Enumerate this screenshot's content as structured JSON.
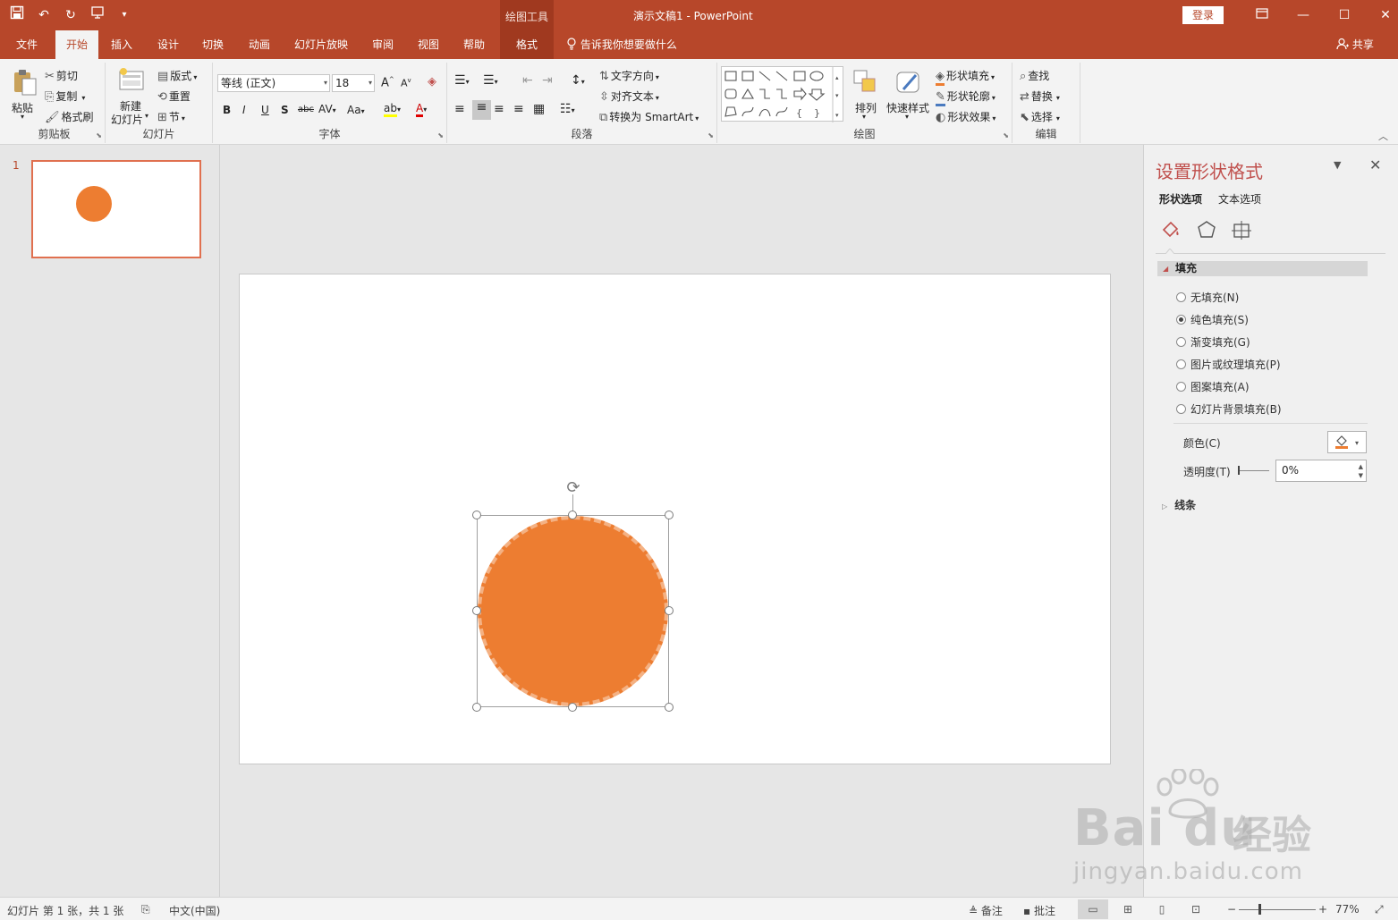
{
  "app": {
    "doc_title": "演示文稿1  -  PowerPoint",
    "context_tools_label": "绘图工具",
    "login": "登录",
    "accent": "#b7472a"
  },
  "qat": {
    "save": "save-icon",
    "undo": "undo-icon",
    "redo": "redo-icon",
    "present": "slideshow-icon",
    "customize": "customize-icon"
  },
  "tabs": [
    {
      "label": "文件"
    },
    {
      "label": "开始"
    },
    {
      "label": "插入"
    },
    {
      "label": "设计"
    },
    {
      "label": "切换"
    },
    {
      "label": "动画"
    },
    {
      "label": "幻灯片放映"
    },
    {
      "label": "审阅"
    },
    {
      "label": "视图"
    },
    {
      "label": "帮助"
    },
    {
      "label": "格式"
    }
  ],
  "tell_me": "告诉我你想要做什么",
  "share": "共享",
  "ribbon": {
    "clipboard": {
      "label": "剪贴板",
      "paste": "粘贴",
      "cut": "剪切",
      "copy": "复制",
      "format_painter": "格式刷"
    },
    "slides": {
      "label": "幻灯片",
      "new_slide_line1": "新建",
      "new_slide_line2": "幻灯片",
      "layout": "版式",
      "reset": "重置",
      "section": "节"
    },
    "font": {
      "label": "字体",
      "font_name": "等线 (正文)",
      "font_size": "18"
    },
    "paragraph": {
      "label": "段落",
      "text_direction": "文字方向",
      "align_text": "对齐文本",
      "smartart": "转换为 SmartArt"
    },
    "drawing": {
      "label": "绘图",
      "arrange": "排列",
      "quick_styles": "快速样式",
      "shape_fill": "形状填充",
      "shape_outline": "形状轮廓",
      "shape_effects": "形状效果"
    },
    "editing": {
      "label": "编辑",
      "find": "查找",
      "replace": "替换",
      "select": "选择"
    }
  },
  "thumbs": {
    "slide_number": "1"
  },
  "pane": {
    "title": "设置形状格式",
    "tab_shape": "形状选项",
    "tab_text": "文本选项",
    "fill_header": "填充",
    "fill_options": [
      {
        "label": "无填充(N)",
        "selected": false
      },
      {
        "label": "纯色填充(S)",
        "selected": true
      },
      {
        "label": "渐变填充(G)",
        "selected": false
      },
      {
        "label": "图片或纹理填充(P)",
        "selected": false
      },
      {
        "label": "图案填充(A)",
        "selected": false
      },
      {
        "label": "幻灯片背景填充(B)",
        "selected": false
      }
    ],
    "color_label": "颜色(C)",
    "transparency_label": "透明度(T)",
    "transparency_value": "0%",
    "line_header": "线条"
  },
  "shape": {
    "fill_color": "#ed7d31",
    "outline_color": "#f4b183"
  },
  "watermark": {
    "brand": "Bai du",
    "cn": "经验",
    "url": "jingyan.baidu.com"
  },
  "status": {
    "slide_info": "幻灯片 第 1 张，共 1 张",
    "language": "中文(中国)",
    "notes": "备注",
    "comments": "批注",
    "zoom": "77%"
  }
}
